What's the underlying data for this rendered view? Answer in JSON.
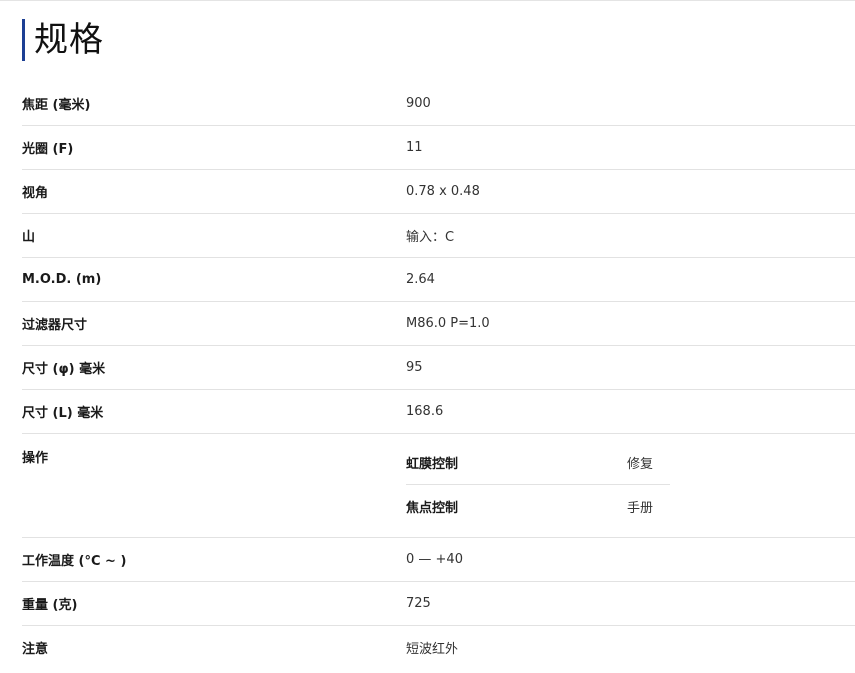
{
  "section": {
    "title": "规格"
  },
  "specs": [
    {
      "label": "焦距 (毫米)",
      "value": "900"
    },
    {
      "label": "光圈 (F)",
      "value": "11"
    },
    {
      "label": "视角",
      "value": "0.78 x 0.48"
    },
    {
      "label": "山",
      "value": "输入：C"
    },
    {
      "label": "M.O.D. (m)",
      "value": "2.64"
    },
    {
      "label": "过滤器尺寸",
      "value": "M86.0 P=1.0"
    },
    {
      "label": "尺寸 (φ) 毫米",
      "value": "95"
    },
    {
      "label": "尺寸 (L) 毫米",
      "value": "168.6"
    }
  ],
  "operation": {
    "label": "操作",
    "items": [
      {
        "label": "虹膜控制",
        "value": "修复"
      },
      {
        "label": "焦点控制",
        "value": "手册"
      }
    ]
  },
  "specs_after": [
    {
      "label": "工作温度 (°C ~ )",
      "value": "0 — +40"
    },
    {
      "label": "重量 (克)",
      "value": "725"
    },
    {
      "label": "注意",
      "value": "短波红外"
    }
  ]
}
